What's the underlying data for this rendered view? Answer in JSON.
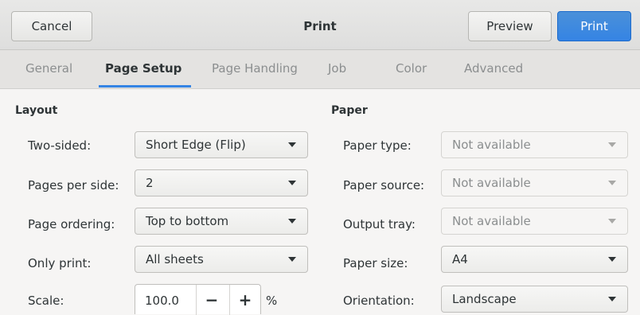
{
  "header": {
    "cancel_label": "Cancel",
    "title": "Print",
    "preview_label": "Preview",
    "print_label": "Print"
  },
  "tabs": [
    {
      "label": "General"
    },
    {
      "label": "Page Setup"
    },
    {
      "label": "Page Handling"
    },
    {
      "label": "Job"
    },
    {
      "label": "Color"
    },
    {
      "label": "Advanced"
    }
  ],
  "active_tab": "Page Setup",
  "layout": {
    "section_title": "Layout",
    "two_sided": {
      "label": "Two-sided:",
      "value": "Short Edge (Flip)"
    },
    "pages_per_side": {
      "label": "Pages per side:",
      "value": "2"
    },
    "page_ordering": {
      "label": "Page ordering:",
      "value": "Top to bottom"
    },
    "only_print": {
      "label": "Only print:",
      "value": "All sheets"
    },
    "scale": {
      "label": "Scale:",
      "value": "100.0",
      "minus": "−",
      "plus": "+",
      "unit": "%"
    }
  },
  "paper": {
    "section_title": "Paper",
    "paper_type": {
      "label": "Paper type:",
      "value": "Not available"
    },
    "paper_source": {
      "label": "Paper source:",
      "value": "Not available"
    },
    "output_tray": {
      "label": "Output tray:",
      "value": "Not available"
    },
    "paper_size": {
      "label": "Paper size:",
      "value": "A4"
    },
    "orientation": {
      "label": "Orientation:",
      "value": "Landscape"
    }
  },
  "colors": {
    "accent": "#3584e4",
    "disabled_text": "#8b8e8f"
  }
}
